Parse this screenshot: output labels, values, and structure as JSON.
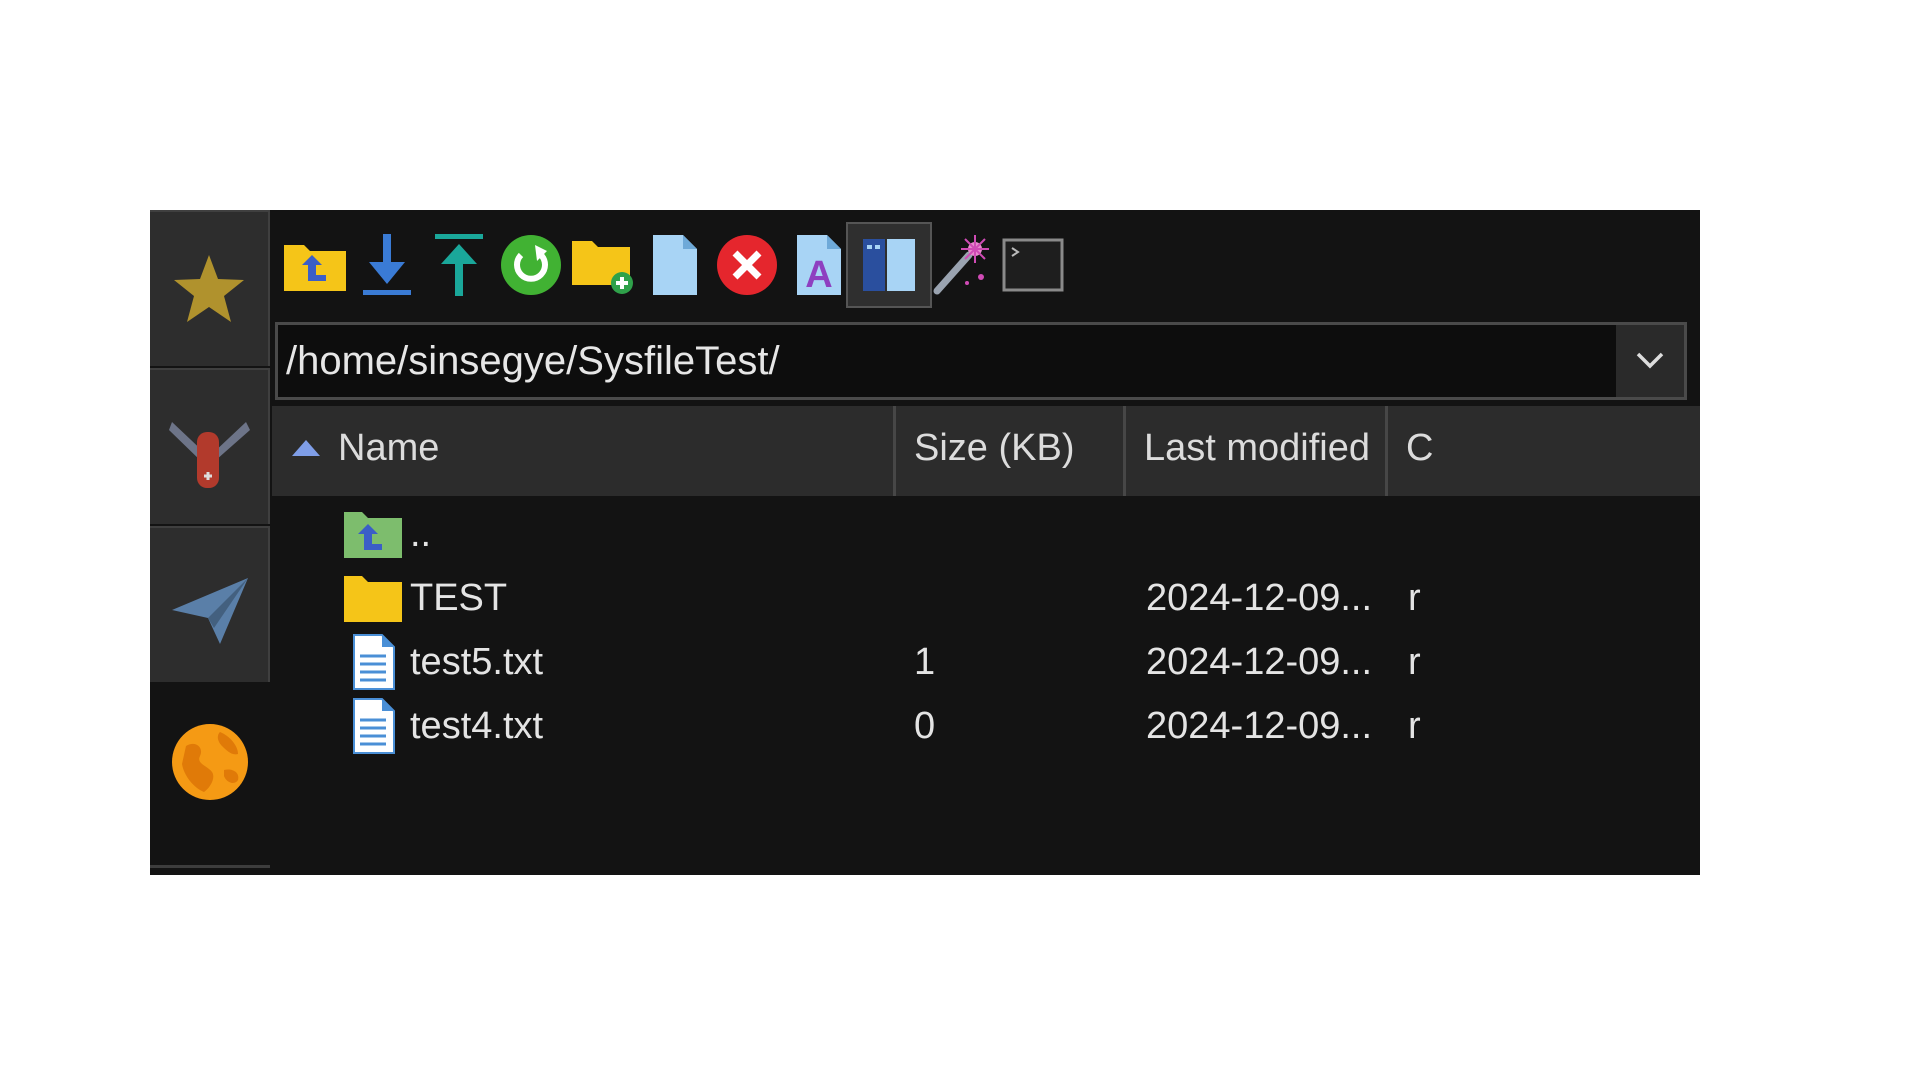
{
  "toolbar": {
    "buttons": [
      {
        "name": "parent-folder",
        "icon": "folder-up-icon"
      },
      {
        "name": "download",
        "icon": "download-arrow-icon"
      },
      {
        "name": "upload",
        "icon": "upload-arrow-icon"
      },
      {
        "name": "refresh",
        "icon": "refresh-icon"
      },
      {
        "name": "new-folder",
        "icon": "new-folder-icon"
      },
      {
        "name": "new-file",
        "icon": "new-file-icon"
      },
      {
        "name": "delete",
        "icon": "delete-icon"
      },
      {
        "name": "rename",
        "icon": "rename-icon"
      },
      {
        "name": "split-view",
        "icon": "split-view-icon",
        "pressed": true
      },
      {
        "name": "magic-wand",
        "icon": "magic-wand-icon"
      },
      {
        "name": "terminal",
        "icon": "terminal-icon"
      }
    ]
  },
  "path": {
    "value": "/home/sinsegye/SysfileTest/"
  },
  "columns": {
    "name": "Name",
    "size": "Size (KB)",
    "modified": "Last modified",
    "extra": "C"
  },
  "rows": [
    {
      "name": "..",
      "size": "",
      "modified": "",
      "extra": "",
      "type": "parent"
    },
    {
      "name": "TEST",
      "size": "",
      "modified": "2024-12-09...",
      "extra": "r",
      "type": "folder"
    },
    {
      "name": "test5.txt",
      "size": "1",
      "modified": "2024-12-09...",
      "extra": "r",
      "type": "file"
    },
    {
      "name": "test4.txt",
      "size": "0",
      "modified": "2024-12-09...",
      "extra": "r",
      "type": "file"
    }
  ],
  "colors": {
    "background": "#131313",
    "header": "#2c2c2c",
    "text": "#e4e4e4",
    "folder": "#f5c518",
    "sort_arrow": "#7f9ee8"
  }
}
